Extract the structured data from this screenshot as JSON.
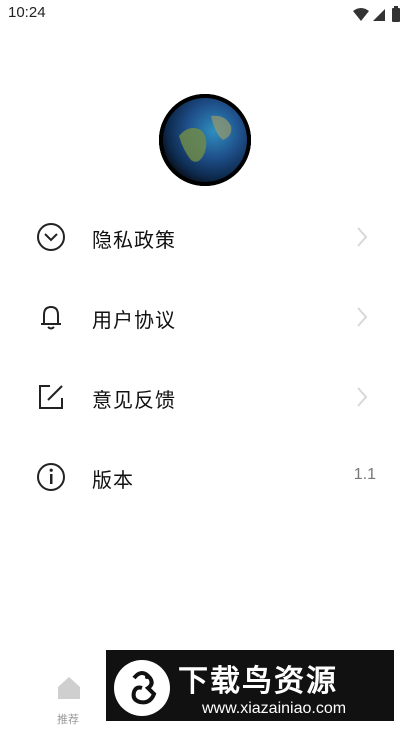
{
  "status_bar": {
    "time": "10:24"
  },
  "menu": {
    "items": [
      {
        "label": "隐私政策",
        "icon": "chevron-circle-icon",
        "has_arrow": true
      },
      {
        "label": "用户协议",
        "icon": "bell-icon",
        "has_arrow": true
      },
      {
        "label": "意见反馈",
        "icon": "edit-icon",
        "has_arrow": true
      },
      {
        "label": "版本",
        "icon": "info-icon",
        "value": "1.1"
      }
    ]
  },
  "bottom_nav": {
    "home_label": "推荐"
  },
  "watermark": {
    "title": "下载鸟资源",
    "url": "www.xiazainiao.com"
  },
  "colors": {
    "text": "#111111",
    "muted": "#777777",
    "chevron": "#d8d8d8"
  }
}
